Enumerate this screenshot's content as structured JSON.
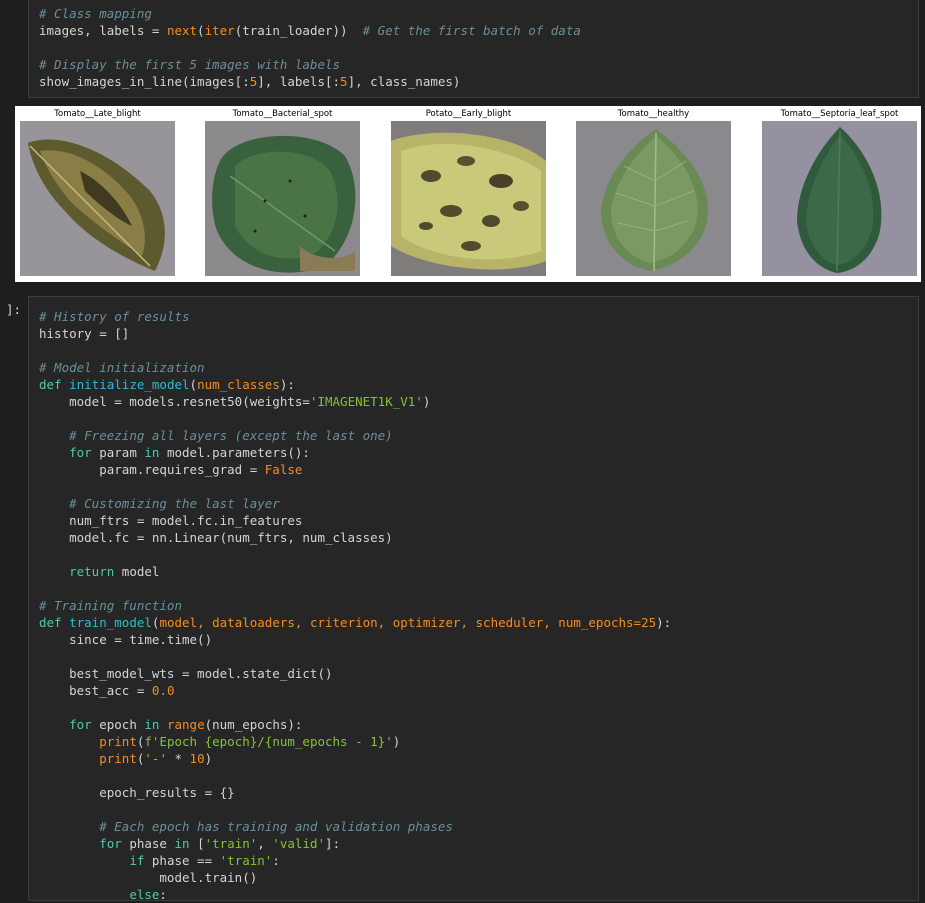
{
  "cell1": {
    "lines": [
      "# Class mapping",
      "images, labels = next(iter(train_loader))  # Get the first batch of data",
      "",
      "# Display the first 5 images with labels",
      "show_images_in_line(images[:5], labels[:5], class_names)"
    ]
  },
  "output": {
    "titles": [
      "Tomato__Late_blight",
      "Tomato__Bacterial_spot",
      "Potato__Early_blight",
      "Tomato__healthy",
      "Tomato__Septoria_leaf_spot"
    ]
  },
  "cell2": {
    "prompt": "]:",
    "lines": [
      "# History of results",
      "history = []",
      "",
      "# Model initialization",
      "def initialize_model(num_classes):",
      "    model = models.resnet50(weights='IMAGENET1K_V1')",
      "",
      "    # Freezing all layers (except the last one)",
      "    for param in model.parameters():",
      "        param.requires_grad = False",
      "",
      "    # Customizing the last layer",
      "    num_ftrs = model.fc.in_features",
      "    model.fc = nn.Linear(num_ftrs, num_classes)",
      "",
      "    return model",
      "",
      "# Training function",
      "def train_model(model, dataloaders, criterion, optimizer, scheduler, num_epochs=25):",
      "    since = time.time()",
      "",
      "    best_model_wts = model.state_dict()",
      "    best_acc = 0.0",
      "",
      "    for epoch in range(num_epochs):",
      "        print(f'Epoch {epoch}/{num_epochs - 1}')",
      "        print('-' * 10)",
      "",
      "        epoch_results = {}",
      "",
      "        # Each epoch has training and validation phases",
      "        for phase in ['train', 'valid']:",
      "            if phase == 'train':",
      "                model.train()",
      "            else:"
    ]
  }
}
